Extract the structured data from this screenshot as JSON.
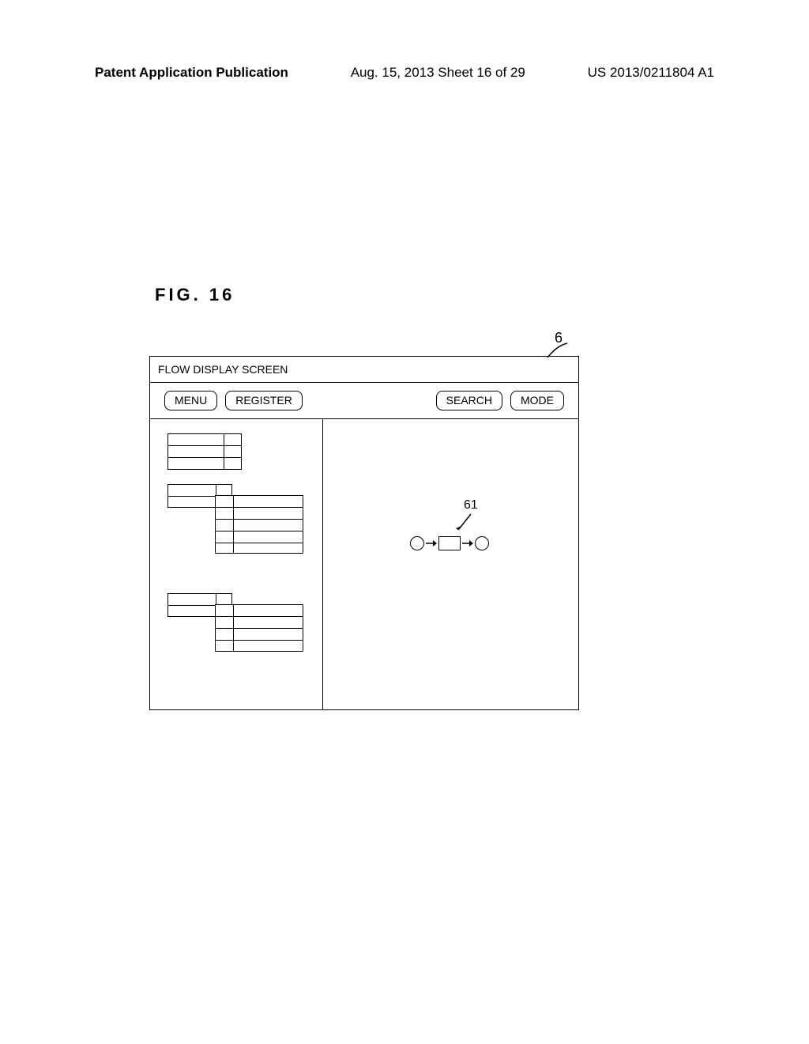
{
  "header": {
    "left": "Patent Application Publication",
    "center": "Aug. 15, 2013  Sheet 16 of 29",
    "right": "US 2013/0211804 A1"
  },
  "figure_label": "FIG. 16",
  "window": {
    "title": "FLOW DISPLAY SCREEN",
    "buttons": {
      "menu": "MENU",
      "register": "REGISTER",
      "search": "SEARCH",
      "mode": "MODE"
    }
  },
  "refs": {
    "window": "6",
    "flow_unit": "61"
  }
}
